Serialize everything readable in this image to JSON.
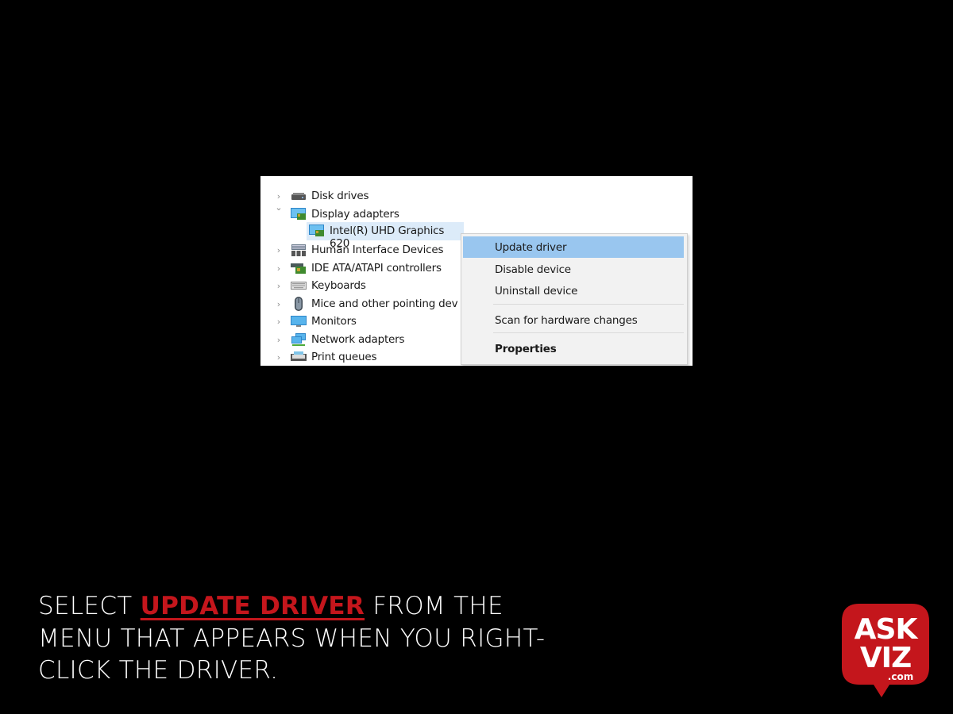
{
  "device_manager": {
    "categories": [
      {
        "label": "Disk drives",
        "expanded": false,
        "icon": "disk-drive-icon"
      },
      {
        "label": "Display adapters",
        "expanded": true,
        "icon": "display-adapter-icon",
        "children": [
          {
            "label": "Intel(R) UHD Graphics 620",
            "icon": "display-adapter-icon",
            "selected": true
          }
        ]
      },
      {
        "label": "Human Interface Devices",
        "expanded": false,
        "icon": "hid-icon"
      },
      {
        "label": "IDE ATA/ATAPI controllers",
        "expanded": false,
        "icon": "ide-controller-icon"
      },
      {
        "label": "Keyboards",
        "expanded": false,
        "icon": "keyboard-icon"
      },
      {
        "label": "Mice and other pointing dev",
        "expanded": false,
        "icon": "mouse-icon"
      },
      {
        "label": "Monitors",
        "expanded": false,
        "icon": "monitor-icon"
      },
      {
        "label": "Network adapters",
        "expanded": false,
        "icon": "network-adapter-icon"
      },
      {
        "label": "Print queues",
        "expanded": false,
        "icon": "printer-icon"
      }
    ],
    "chevron_collapsed": "›",
    "chevron_expanded": "⌄"
  },
  "context_menu": {
    "items": [
      {
        "label": "Update driver",
        "highlighted": true
      },
      {
        "label": "Disable device"
      },
      {
        "label": "Uninstall device"
      },
      {
        "label": "Scan for hardware changes"
      },
      {
        "label": "Properties",
        "bold": true
      }
    ]
  },
  "caption": {
    "prefix": "SELECT ",
    "highlight": "UPDATE DRIVER",
    "suffix": " FROM THE MENU THAT APPEARS WHEN YOU RIGHT-CLICK THE DRIVER.",
    "highlight_color": "#c4161c"
  },
  "logo": {
    "line1": "ASK",
    "line2": "VIZ",
    "domain": ".com",
    "color": "#c4161c"
  }
}
